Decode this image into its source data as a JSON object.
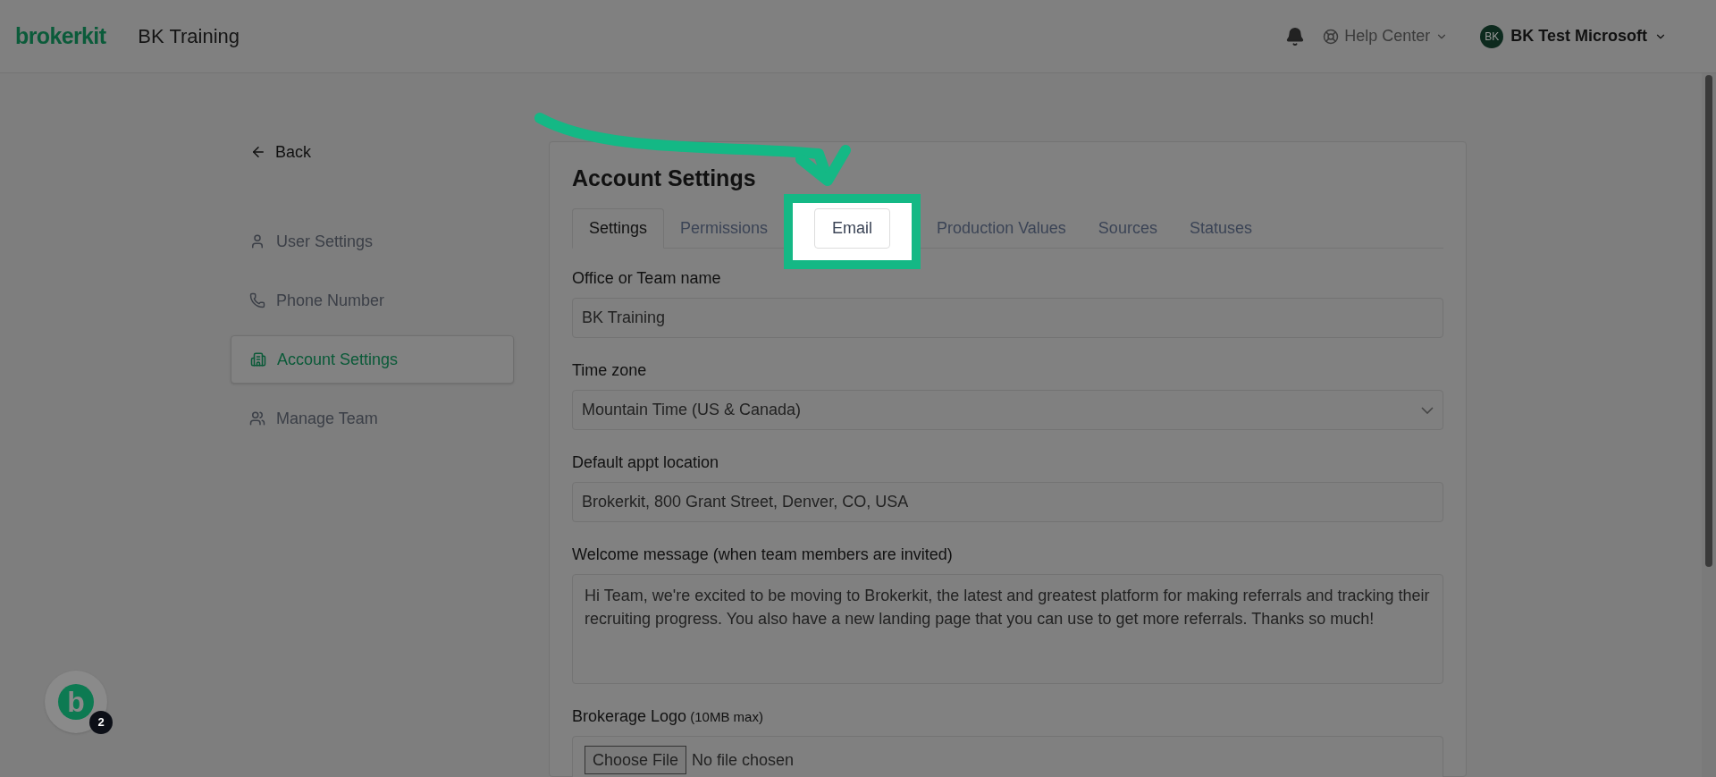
{
  "header": {
    "logo": "brokerkit",
    "account_name": "BK Training",
    "help": "Help Center",
    "user": {
      "initials": "BK",
      "name": "BK Test Microsoft"
    }
  },
  "sidebar": {
    "back": "Back",
    "items": [
      {
        "label": "User Settings",
        "selected": false
      },
      {
        "label": "Phone Number",
        "selected": false
      },
      {
        "label": "Account Settings",
        "selected": true
      },
      {
        "label": "Manage Team",
        "selected": false
      }
    ]
  },
  "card": {
    "title": "Account Settings",
    "tabs": [
      {
        "label": "Settings",
        "selected": true,
        "highlighted": false
      },
      {
        "label": "Permissions",
        "selected": false,
        "highlighted": false
      },
      {
        "label": "Email",
        "selected": false,
        "highlighted": true
      },
      {
        "label": "Production Values",
        "selected": false,
        "highlighted": false
      },
      {
        "label": "Sources",
        "selected": false,
        "highlighted": false
      },
      {
        "label": "Statuses",
        "selected": false,
        "highlighted": false
      }
    ],
    "fields": [
      {
        "kind": "text",
        "label": "Office or Team name",
        "value": "BK Training"
      },
      {
        "kind": "select",
        "label": "Time zone",
        "value": "Mountain Time (US & Canada)"
      },
      {
        "kind": "text",
        "label": "Default appt location",
        "value": "Brokerkit, 800 Grant Street, Denver, CO, USA"
      },
      {
        "kind": "textarea",
        "label": "Welcome message (when team members are invited)",
        "value": "Hi Team, we're excited to be moving to Brokerkit, the latest and greatest platform for making referrals and tracking their recruiting progress. You also have a new landing page that you can use to get more referrals. Thanks so much!"
      },
      {
        "kind": "file",
        "label": "Brokerage Logo",
        "note": "(10MB max)",
        "button": "Choose File",
        "value": "No file chosen"
      }
    ]
  },
  "chat": {
    "letter": "b",
    "badge": "2"
  }
}
